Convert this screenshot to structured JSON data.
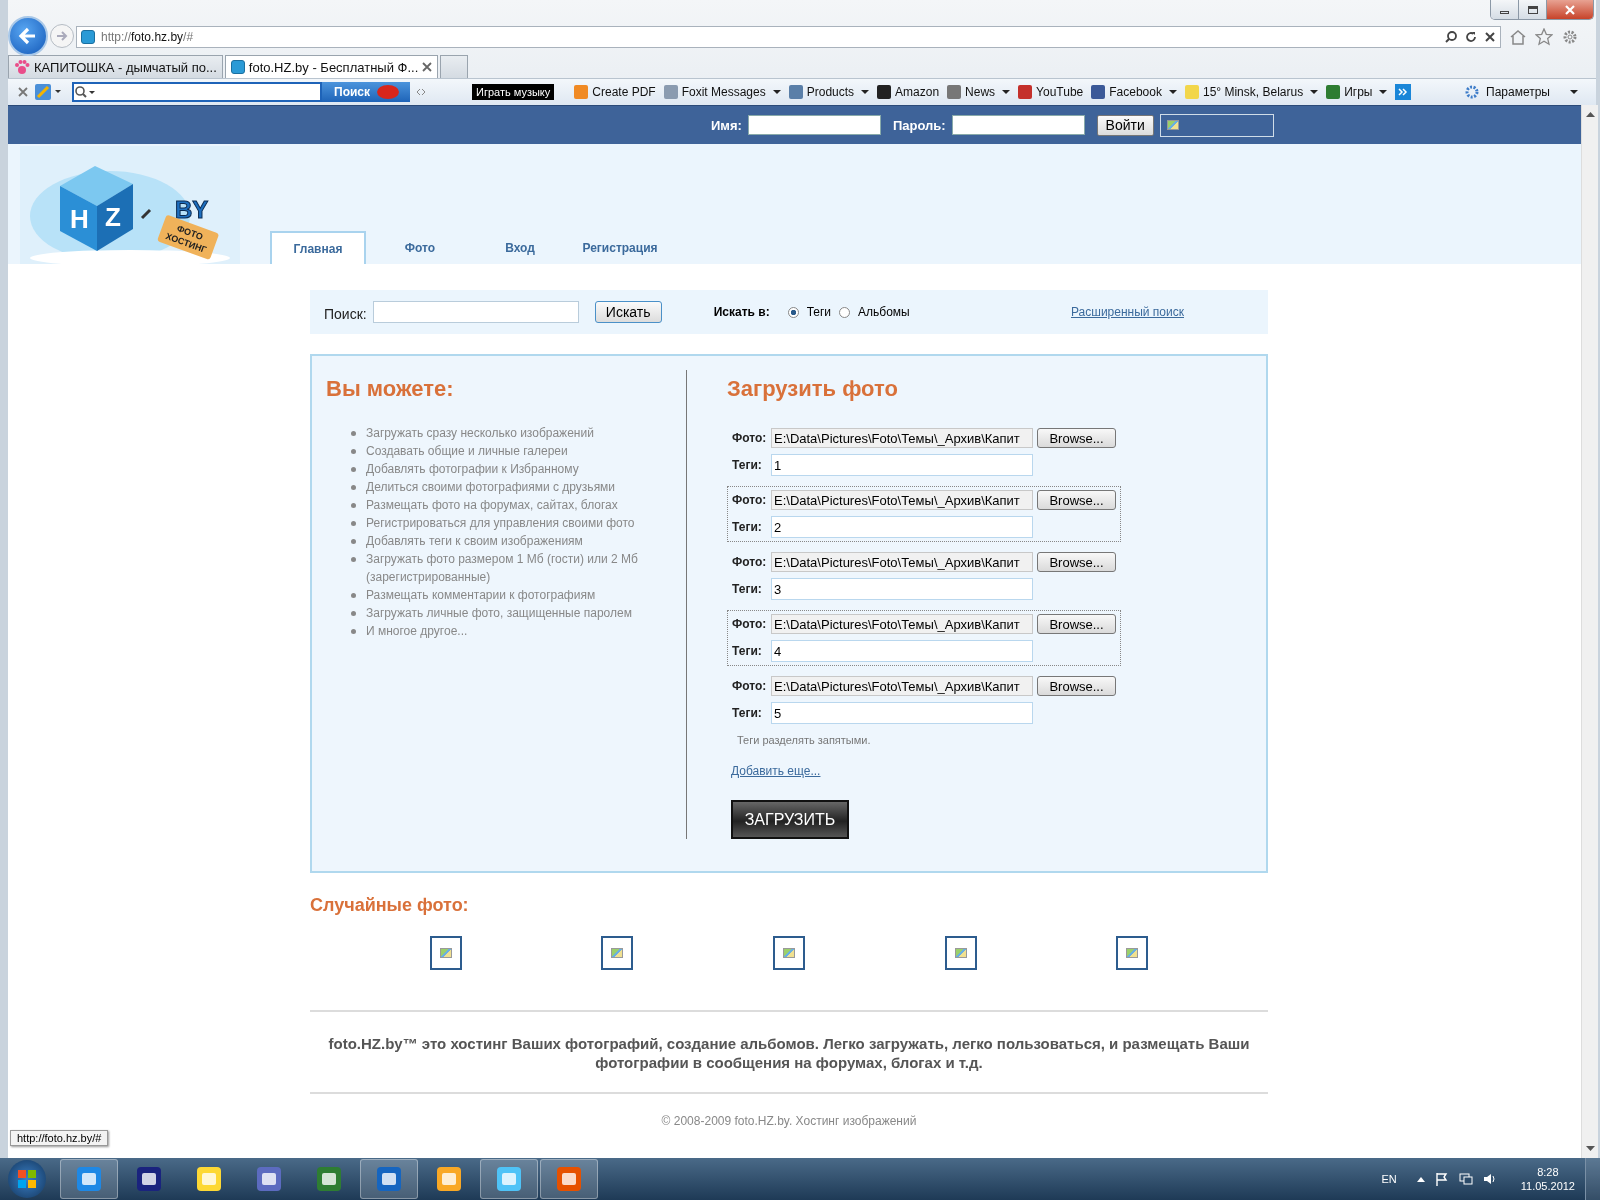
{
  "browser": {
    "url_prefix": "http://",
    "url_host": "foto.hz.by",
    "url_rest": "/#",
    "tabs": [
      {
        "label": "КАПИТОШКА - дымчатый по...",
        "selected": false
      },
      {
        "label": "foto.HZ.by - Бесплатный Ф...",
        "selected": true
      }
    ]
  },
  "toolbar": {
    "search_button": "Поиск",
    "music_button": "Играть музыку",
    "settings": "Параметры",
    "items": [
      {
        "label": "Create PDF",
        "dropdown": false
      },
      {
        "label": "Foxit Messages",
        "dropdown": true
      },
      {
        "label": "Products",
        "dropdown": true
      },
      {
        "label": "Amazon",
        "dropdown": false
      },
      {
        "label": "News",
        "dropdown": true
      },
      {
        "label": "YouTube",
        "dropdown": false
      },
      {
        "label": "Facebook",
        "dropdown": true
      },
      {
        "label": "15° Minsk, Belarus",
        "dropdown": true
      },
      {
        "label": "Игры",
        "dropdown": true
      }
    ]
  },
  "login": {
    "name_label": "Имя:",
    "password_label": "Пароль:",
    "button": "Войти"
  },
  "logo": {
    "left_face": "H",
    "right_face": "Z",
    "domain": "BY",
    "tag_line1": "ФОТО",
    "tag_line2": "ХОСТИНГ"
  },
  "nav_tabs": [
    {
      "label": "Главная",
      "selected": true
    },
    {
      "label": "Фото",
      "selected": false
    },
    {
      "label": "Вход",
      "selected": false
    },
    {
      "label": "Регистрация",
      "selected": false
    }
  ],
  "search": {
    "label": "Поиск:",
    "button": "Искать",
    "scope_label": "Искать в:",
    "options": [
      {
        "label": "Теги",
        "selected": true
      },
      {
        "label": "Альбомы",
        "selected": false
      }
    ],
    "advanced_link": "Расширенный поиск"
  },
  "features": {
    "title": "Вы можете:",
    "items": [
      "Загружать сразу несколько изображений",
      "Создавать общие и личные галереи",
      "Добавлять фотографии к Избранному",
      "Делиться своими фотографиями с друзьями",
      "Размещать фото на форумах, сайтах, блогах",
      "Регистрироваться для управления своими фото",
      "Добавлять теги к своим изображениям",
      "Загружать фото размером 1 Мб (гости) или 2 Мб (зарегистрированные)",
      "Размещать комментарии к фотографиям",
      "Загружать личные фото, защищенные паролем",
      "И многое другое..."
    ]
  },
  "upload": {
    "title": "Загрузить фото",
    "rows": [
      {
        "photo_label": "Фото:",
        "path": "E:\\Data\\Pictures\\Foto\\Темы\\_Архив\\Капит",
        "browse": "Browse...",
        "tags_label": "Теги:",
        "tags": "1",
        "highlighted": false
      },
      {
        "photo_label": "Фото:",
        "path": "E:\\Data\\Pictures\\Foto\\Темы\\_Архив\\Капит",
        "browse": "Browse...",
        "tags_label": "Теги:",
        "tags": "2",
        "highlighted": true
      },
      {
        "photo_label": "Фото:",
        "path": "E:\\Data\\Pictures\\Foto\\Темы\\_Архив\\Капит",
        "browse": "Browse...",
        "tags_label": "Теги:",
        "tags": "3",
        "highlighted": false
      },
      {
        "photo_label": "Фото:",
        "path": "E:\\Data\\Pictures\\Foto\\Темы\\_Архив\\Капит",
        "browse": "Browse...",
        "tags_label": "Теги:",
        "tags": "4",
        "highlighted": true
      },
      {
        "photo_label": "Фото:",
        "path": "E:\\Data\\Pictures\\Foto\\Темы\\_Архив\\Капит",
        "browse": "Browse...",
        "tags_label": "Теги:",
        "tags": "5",
        "highlighted": false
      }
    ],
    "hint": "Теги разделять запятыми.",
    "add_more": "Добавить еще...",
    "submit": "ЗАГРУЗИТЬ"
  },
  "random_photos": {
    "title": "Случайные фото:"
  },
  "footer": {
    "description": "foto.HZ.by™ это хостинг Ваших фотографий, создание альбомов. Легко загружать, легко пользоваться, и размещать Ваши фотографии в сообщения на форумах, блогах и т.д.",
    "copyright": "© 2008-2009 foto.HZ.by. Хостинг изображений"
  },
  "status_url": "http://foto.hz.by/#",
  "taskbar": {
    "language": "EN",
    "time": "8:28",
    "date": "11.05.2012"
  }
}
